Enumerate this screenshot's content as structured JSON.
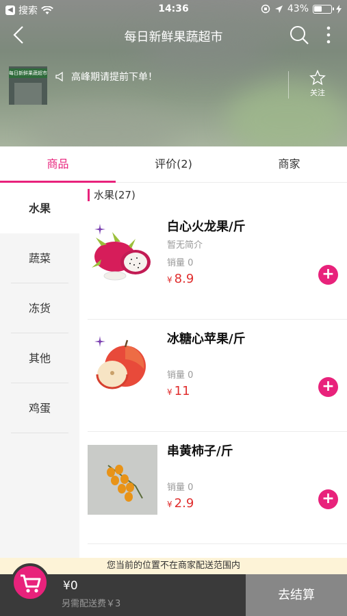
{
  "status_bar": {
    "carrier": "搜索",
    "time": "14:36",
    "battery": "43%"
  },
  "navbar": {
    "title": "每日新鲜果蔬超市"
  },
  "shop": {
    "sign_text": "每日新鲜果蔬超市",
    "notice": "高峰期请提前下单！",
    "follow_label": "关注"
  },
  "tabs": [
    {
      "label": "商品",
      "active": true
    },
    {
      "label": "评价(2)",
      "active": false
    },
    {
      "label": "商家",
      "active": false
    }
  ],
  "categories": [
    {
      "label": "水果",
      "active": true
    },
    {
      "label": "蔬菜",
      "active": false
    },
    {
      "label": "冻货",
      "active": false
    },
    {
      "label": "其他",
      "active": false
    },
    {
      "label": "鸡蛋",
      "active": false
    }
  ],
  "list_header": "水果(27)",
  "products": [
    {
      "name": "白心火龙果/斤",
      "desc": "暂无简介",
      "sales": "销量 0",
      "currency": "¥",
      "price": "8.9",
      "image": "dragon-fruit",
      "badge": true
    },
    {
      "name": "冰糖心苹果/斤",
      "desc": "",
      "sales": "销量 0",
      "currency": "¥",
      "price": "11",
      "image": "apple",
      "badge": true
    },
    {
      "name": "串黄柿子/斤",
      "desc": "",
      "sales": "销量 0",
      "currency": "¥",
      "price": "2.9",
      "image": "yellow-tomatoes",
      "badge": false
    }
  ],
  "add_label": "+",
  "range_tip": "您当前的位置不在商家配送范围内",
  "cart": {
    "total": "¥0",
    "delivery_fee": "另需配送费￥3",
    "checkout_label": "去结算"
  },
  "colors": {
    "accent": "#e8227b",
    "price": "#e02d2d",
    "cartbar": "#3a3a3a",
    "checkout": "#878787"
  }
}
